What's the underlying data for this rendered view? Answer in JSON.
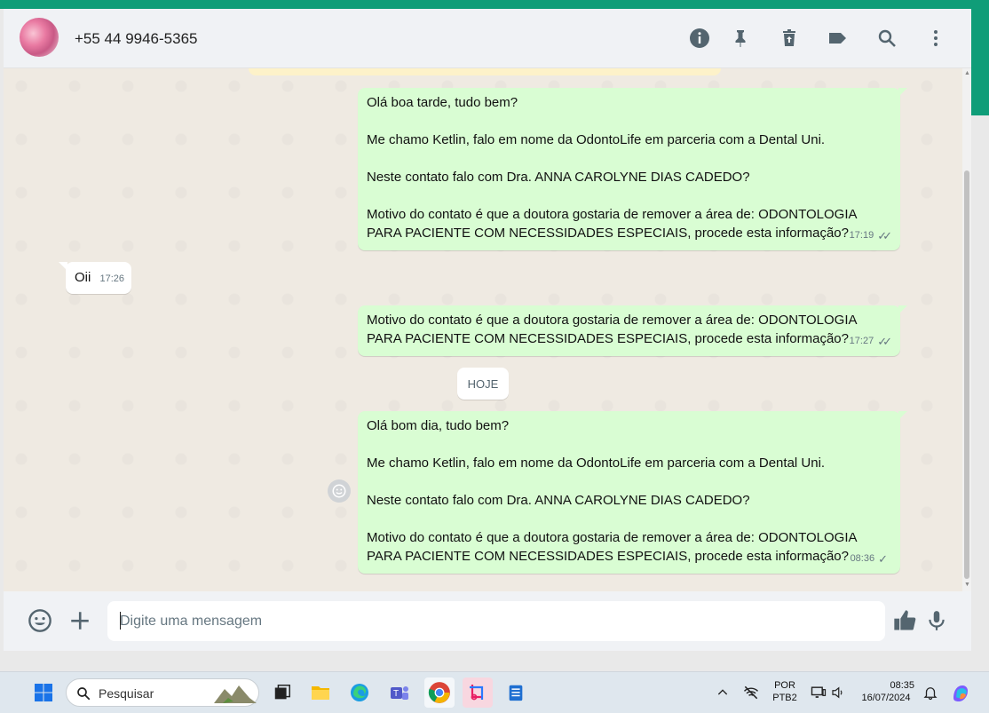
{
  "contact": {
    "phone": "+55 44 9946-5365"
  },
  "header_icons": [
    "info-icon",
    "pin-icon",
    "trash-icon",
    "label-icon",
    "search-icon",
    "more-icon"
  ],
  "messages": [
    {
      "direction": "outgoing",
      "lines": [
        "Olá boa tarde, tudo bem?",
        "",
        "Me chamo Ketlin, falo em nome da OdontoLife em parceria com a Dental Uni.",
        "",
        "Neste contato falo com Dra. ANNA CAROLYNE DIAS CADEDO?",
        "",
        "Motivo do contato é que a doutora gostaria de remover a área de: ODONTOLOGIA",
        "PARA PACIENTE COM NECESSIDADES ESPECIAIS, procede esta informação?"
      ],
      "time": "17:19",
      "status": "read"
    },
    {
      "direction": "incoming",
      "lines": [
        "Oii"
      ],
      "time": "17:26"
    },
    {
      "direction": "outgoing",
      "lines": [
        "Motivo do contato é que a doutora gostaria de remover a área de: ODONTOLOGIA",
        "PARA PACIENTE COM NECESSIDADES ESPECIAIS, procede esta informação?"
      ],
      "time": "17:27",
      "status": "read"
    },
    {
      "direction": "outgoing",
      "lines": [
        "Olá bom dia, tudo bem?",
        "",
        "Me chamo Ketlin, falo em nome da OdontoLife em parceria com a Dental Uni.",
        "",
        "Neste contato falo com Dra. ANNA CAROLYNE DIAS CADEDO?",
        "",
        "Motivo do contato é que a doutora gostaria de remover a área de: ODONTOLOGIA",
        "PARA PACIENTE COM NECESSIDADES ESPECIAIS, procede esta informação?"
      ],
      "time": "08:36",
      "status": "sent"
    }
  ],
  "date_divider": "HOJE",
  "composer": {
    "placeholder": "Digite uma mensagem"
  },
  "taskbar": {
    "search_label": "Pesquisar",
    "language_top": "POR",
    "language_bottom": "PTB2",
    "clock_time": "08:35",
    "clock_date": "16/07/2024"
  },
  "colors": {
    "outgoing_bubble": "#d9fdd3",
    "incoming_bubble": "#ffffff",
    "chat_background": "#efeae2",
    "accent_green": "#0f9d78"
  }
}
